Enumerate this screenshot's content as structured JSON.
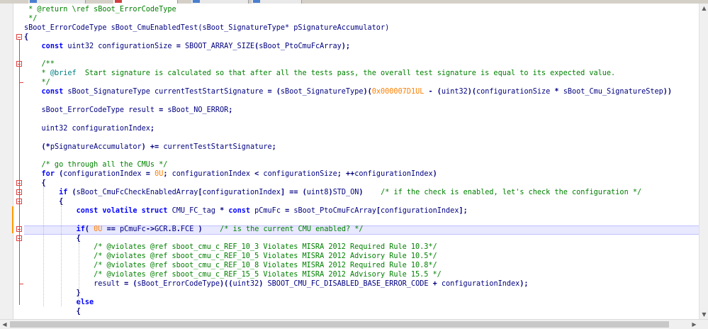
{
  "editor": {
    "lines": [
      [
        {
          "c": "cm",
          "t": " * @return \\ref sBoot_ErrorCodeType"
        }
      ],
      [
        {
          "c": "cm",
          "t": " */"
        }
      ],
      [
        {
          "c": "ty",
          "t": "sBoot_ErrorCodeType sBoot_CmuEnabledTest(sBoot_SignatureType* pSignatureAccumulator)"
        }
      ],
      [
        {
          "c": "op",
          "t": "{"
        }
      ],
      [
        {
          "c": "ty",
          "t": "    "
        },
        {
          "c": "kw",
          "t": "const"
        },
        {
          "c": "ty",
          "t": " uint32 configurationSize "
        },
        {
          "c": "op",
          "t": "="
        },
        {
          "c": "ty",
          "t": " SBOOT_ARRAY_SIZE"
        },
        {
          "c": "op",
          "t": "("
        },
        {
          "c": "ty",
          "t": "sBoot_PtoCmuFcArray"
        },
        {
          "c": "op",
          "t": ");"
        }
      ],
      [
        {
          "c": "ty",
          "t": ""
        }
      ],
      [
        {
          "c": "cm",
          "t": "    /**"
        }
      ],
      [
        {
          "c": "cm",
          "t": "    * "
        },
        {
          "c": "dk",
          "t": "@brief"
        },
        {
          "c": "cm",
          "t": "  Start signature is calculated so that after all the tests pass, the overall test signature is equal to its expected value."
        }
      ],
      [
        {
          "c": "cm",
          "t": "    */"
        }
      ],
      [
        {
          "c": "ty",
          "t": "    "
        },
        {
          "c": "kw",
          "t": "const"
        },
        {
          "c": "ty",
          "t": " sBoot_SignatureType currentTestStartSignature "
        },
        {
          "c": "op",
          "t": "="
        },
        {
          "c": "ty",
          "t": " "
        },
        {
          "c": "op",
          "t": "("
        },
        {
          "c": "ty",
          "t": "sBoot_SignatureType"
        },
        {
          "c": "op",
          "t": ")("
        },
        {
          "c": "num",
          "t": "0x000007D1UL"
        },
        {
          "c": "ty",
          "t": " "
        },
        {
          "c": "op",
          "t": "-"
        },
        {
          "c": "ty",
          "t": " "
        },
        {
          "c": "op",
          "t": "("
        },
        {
          "c": "ty",
          "t": "uint32"
        },
        {
          "c": "op",
          "t": ")("
        },
        {
          "c": "ty",
          "t": "configurationSize "
        },
        {
          "c": "op",
          "t": "*"
        },
        {
          "c": "ty",
          "t": " sBoot_Cmu_SignatureStep"
        },
        {
          "c": "op",
          "t": "))"
        }
      ],
      [
        {
          "c": "ty",
          "t": ""
        }
      ],
      [
        {
          "c": "ty",
          "t": "    sBoot_ErrorCodeType result "
        },
        {
          "c": "op",
          "t": "="
        },
        {
          "c": "ty",
          "t": " sBoot_NO_ERROR"
        },
        {
          "c": "op",
          "t": ";"
        }
      ],
      [
        {
          "c": "ty",
          "t": ""
        }
      ],
      [
        {
          "c": "ty",
          "t": "    uint32 configurationIndex"
        },
        {
          "c": "op",
          "t": ";"
        }
      ],
      [
        {
          "c": "ty",
          "t": ""
        }
      ],
      [
        {
          "c": "ty",
          "t": "    "
        },
        {
          "c": "op",
          "t": "(*"
        },
        {
          "c": "ty",
          "t": "pSignatureAccumulator"
        },
        {
          "c": "op",
          "t": ")"
        },
        {
          "c": "ty",
          "t": " "
        },
        {
          "c": "op",
          "t": "+="
        },
        {
          "c": "ty",
          "t": " currentTestStartSignature"
        },
        {
          "c": "op",
          "t": ";"
        }
      ],
      [
        {
          "c": "ty",
          "t": ""
        }
      ],
      [
        {
          "c": "cm",
          "t": "    /* go through all the CMUs */"
        }
      ],
      [
        {
          "c": "ty",
          "t": "    "
        },
        {
          "c": "kw",
          "t": "for"
        },
        {
          "c": "ty",
          "t": " "
        },
        {
          "c": "op",
          "t": "("
        },
        {
          "c": "ty",
          "t": "configurationIndex "
        },
        {
          "c": "op",
          "t": "="
        },
        {
          "c": "ty",
          "t": " "
        },
        {
          "c": "num",
          "t": "0U"
        },
        {
          "c": "op",
          "t": ";"
        },
        {
          "c": "ty",
          "t": " configurationIndex "
        },
        {
          "c": "op",
          "t": "<"
        },
        {
          "c": "ty",
          "t": " configurationSize"
        },
        {
          "c": "op",
          "t": ";"
        },
        {
          "c": "ty",
          "t": " "
        },
        {
          "c": "op",
          "t": "++"
        },
        {
          "c": "ty",
          "t": "configurationIndex"
        },
        {
          "c": "op",
          "t": ")"
        }
      ],
      [
        {
          "c": "ty",
          "t": "    "
        },
        {
          "c": "op",
          "t": "{"
        }
      ],
      [
        {
          "c": "ty",
          "t": "        "
        },
        {
          "c": "kw",
          "t": "if"
        },
        {
          "c": "ty",
          "t": " "
        },
        {
          "c": "op",
          "t": "("
        },
        {
          "c": "ty",
          "t": "sBoot_CmuFcCheckEnabledArray"
        },
        {
          "c": "op",
          "t": "["
        },
        {
          "c": "ty",
          "t": "configurationIndex"
        },
        {
          "c": "op",
          "t": "]"
        },
        {
          "c": "ty",
          "t": " "
        },
        {
          "c": "op",
          "t": "=="
        },
        {
          "c": "ty",
          "t": " "
        },
        {
          "c": "op",
          "t": "("
        },
        {
          "c": "ty",
          "t": "uint8"
        },
        {
          "c": "op",
          "t": ")"
        },
        {
          "c": "ty",
          "t": "STD_ON"
        },
        {
          "c": "op",
          "t": ")"
        },
        {
          "c": "ty",
          "t": "    "
        },
        {
          "c": "cm",
          "t": "/* if the check is enabled, let's check the configuration */"
        }
      ],
      [
        {
          "c": "ty",
          "t": "        "
        },
        {
          "c": "op",
          "t": "{"
        }
      ],
      [
        {
          "c": "ty",
          "t": "            "
        },
        {
          "c": "kw",
          "t": "const"
        },
        {
          "c": "ty",
          "t": " "
        },
        {
          "c": "kw",
          "t": "volatile"
        },
        {
          "c": "ty",
          "t": " "
        },
        {
          "c": "kw",
          "t": "struct"
        },
        {
          "c": "ty",
          "t": " CMU_FC_tag "
        },
        {
          "c": "op",
          "t": "*"
        },
        {
          "c": "ty",
          "t": " "
        },
        {
          "c": "kw",
          "t": "const"
        },
        {
          "c": "ty",
          "t": " pCmuFc "
        },
        {
          "c": "op",
          "t": "="
        },
        {
          "c": "ty",
          "t": " sBoot_PtoCmuFcArray"
        },
        {
          "c": "op",
          "t": "["
        },
        {
          "c": "ty",
          "t": "configurationIndex"
        },
        {
          "c": "op",
          "t": "];"
        }
      ],
      [
        {
          "c": "ty",
          "t": ""
        }
      ],
      [
        {
          "c": "ty",
          "t": "            "
        },
        {
          "c": "kw",
          "t": "if"
        },
        {
          "c": "op",
          "t": "("
        },
        {
          "c": "ty",
          "t": " "
        },
        {
          "c": "num",
          "t": "0U"
        },
        {
          "c": "ty",
          "t": " "
        },
        {
          "c": "op",
          "t": "=="
        },
        {
          "c": "ty",
          "t": " pCmuFc"
        },
        {
          "c": "op",
          "t": "->"
        },
        {
          "c": "ty",
          "t": "GCR"
        },
        {
          "c": "op",
          "t": "."
        },
        {
          "c": "ty",
          "t": "B"
        },
        {
          "c": "op",
          "t": "."
        },
        {
          "c": "ty",
          "t": "FCE "
        },
        {
          "c": "op",
          "t": ")"
        },
        {
          "c": "ty",
          "t": "    "
        },
        {
          "c": "cm",
          "t": "/* is the current CMU enabled? */"
        }
      ],
      [
        {
          "c": "ty",
          "t": "            "
        },
        {
          "c": "op",
          "t": "{"
        }
      ],
      [
        {
          "c": "cm",
          "t": "                /* @violates @ref sboot_cmu_c_REF_10_3 Violates MISRA 2012 Required Rule 10.3*/"
        }
      ],
      [
        {
          "c": "cm",
          "t": "                /* @violates @ref sboot_cmu_c_REF_10_5 Violates MISRA 2012 Advisory Rule 10.5*/"
        }
      ],
      [
        {
          "c": "cm",
          "t": "                /* @violates @ref sboot_cmu_c_REF_10_8 Violates MISRA 2012 Required Rule 10.8*/"
        }
      ],
      [
        {
          "c": "cm",
          "t": "                /* @violates @ref sboot_cmu_c_REF_15_5 Violates MISRA 2012 Advisory Rule 15.5 */"
        }
      ],
      [
        {
          "c": "ty",
          "t": "                result "
        },
        {
          "c": "op",
          "t": "="
        },
        {
          "c": "ty",
          "t": " "
        },
        {
          "c": "op",
          "t": "("
        },
        {
          "c": "ty",
          "t": "sBoot_ErrorCodeType"
        },
        {
          "c": "op",
          "t": ")(("
        },
        {
          "c": "ty",
          "t": "uint32"
        },
        {
          "c": "op",
          "t": ")"
        },
        {
          "c": "ty",
          "t": " SBOOT_CMU_FC_DISABLED_BASE_ERROR_CODE "
        },
        {
          "c": "op",
          "t": "+"
        },
        {
          "c": "ty",
          "t": " configurationIndex"
        },
        {
          "c": "op",
          "t": ");"
        }
      ],
      [
        {
          "c": "ty",
          "t": "            "
        },
        {
          "c": "op",
          "t": "}"
        }
      ],
      [
        {
          "c": "ty",
          "t": "            "
        },
        {
          "c": "kw",
          "t": "else"
        }
      ],
      [
        {
          "c": "ty",
          "t": "            "
        },
        {
          "c": "op",
          "t": "{"
        }
      ]
    ]
  },
  "icons": {
    "scroll_left": "arrow-left-icon",
    "scroll_right": "arrow-right-icon",
    "scroll_up": "arrow-up-icon",
    "scroll_down": "arrow-down-icon",
    "fold_marker": "fold-minus-icon"
  },
  "colors": {
    "keyword": "#0000ff",
    "comment": "#008000",
    "number": "#ff8000",
    "highlight": "#e8e8ff",
    "fold": "#e04040"
  }
}
